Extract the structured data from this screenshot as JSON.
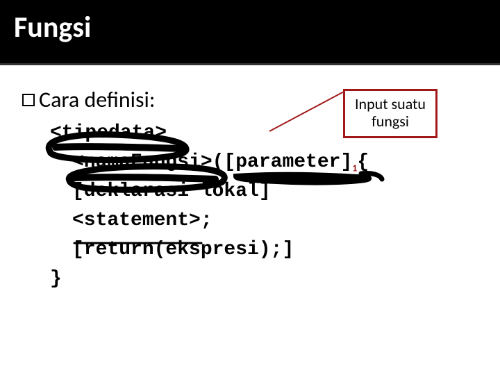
{
  "title": "Fungsi",
  "bullet_text": "Cara definisi:",
  "callout": {
    "line1": "Input suatu",
    "line2": "fungsi"
  },
  "code": {
    "l1": "<tipedata>",
    "l2a": "<namaFungsi>([parameter]",
    "l2b_brace": "{",
    "l2_sub": "1",
    "l3": "[deklarasi lokal]",
    "l4": "<statement>;",
    "l5": "[return(ekspresi);]",
    "l6": "}"
  }
}
